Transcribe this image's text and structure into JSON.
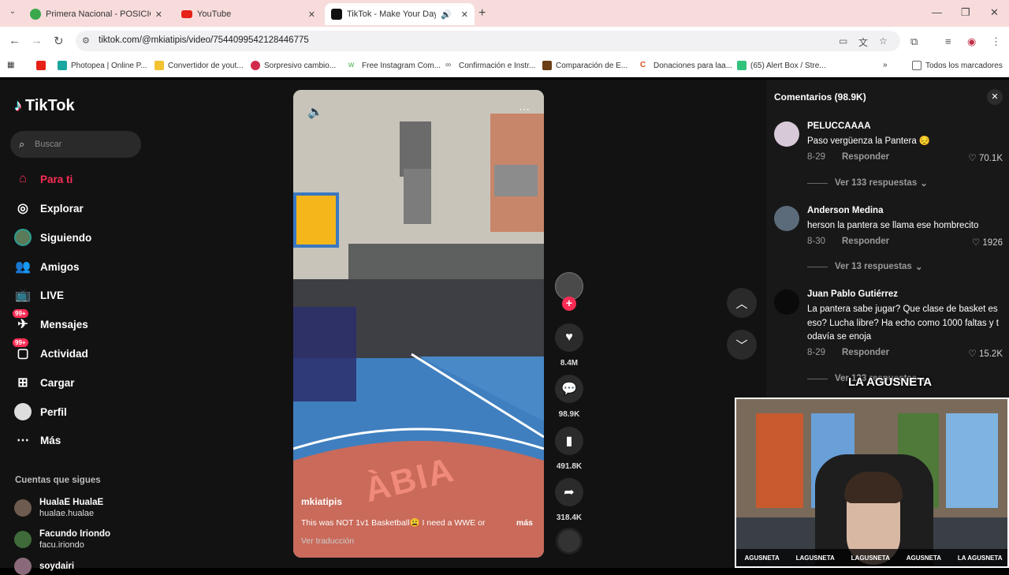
{
  "browser": {
    "tabs": [
      {
        "title": "Primera Nacional - POSICIONES",
        "icon": "globe-green-icon"
      },
      {
        "title": "YouTube",
        "icon": "youtube-icon"
      },
      {
        "title": "TikTok - Make Your Day",
        "icon": "tiktok-icon"
      }
    ],
    "url": "tiktok.com/@mkiatipis/video/7544099542128446775",
    "bookmarks": [
      "Photopea | Online P...",
      "Convertidor de yout...",
      "Sorpresivo cambio...",
      "Free Instagram Com...",
      "Confirmación e Instr...",
      "Comparación de E...",
      "Donaciones para laa...",
      "(65) Alert Box / Stre..."
    ],
    "all_bookmarks": "Todos los marcadores",
    "colors": {
      "tabbar": "#f8dcdc",
      "accent": "#fe2c55"
    }
  },
  "sidebar": {
    "logo": "TikTok",
    "search_placeholder": "Buscar",
    "nav": [
      {
        "label": "Para ti",
        "icon": "home-icon"
      },
      {
        "label": "Explorar",
        "icon": "compass-icon"
      },
      {
        "label": "Siguiendo",
        "icon": "following-avatar-icon"
      },
      {
        "label": "Amigos",
        "icon": "friends-icon"
      },
      {
        "label": "LIVE",
        "icon": "live-tv-icon"
      },
      {
        "label": "Mensajes",
        "icon": "message-icon",
        "badge": "99+"
      },
      {
        "label": "Actividad",
        "icon": "activity-icon",
        "badge": "99+"
      },
      {
        "label": "Cargar",
        "icon": "upload-icon"
      },
      {
        "label": "Perfil",
        "icon": "profile-icon"
      },
      {
        "label": "Más",
        "icon": "more-dots-icon"
      }
    ],
    "following_title": "Cuentas que sigues",
    "following": [
      {
        "name": "HualaE HualaE",
        "handle": "hualae.hualae"
      },
      {
        "name": "Facundo Iriondo",
        "handle": "facu.iriondo"
      },
      {
        "name": "soydairi",
        "handle": ""
      }
    ]
  },
  "video": {
    "author": "mkiatipis",
    "caption": "This was NOT 1v1 Basketball😩 I need a WWE or",
    "more": "más",
    "translate": "Ver traducción",
    "court_text": "ÀBIA"
  },
  "actions": {
    "likes": "8.4M",
    "comments": "98.9K",
    "saves": "491.8K",
    "shares": "318.4K"
  },
  "comments_panel": {
    "title": "Comentarios (98.9K)",
    "reply_label": "Responder",
    "items": [
      {
        "user": "PELUCCAAAA",
        "text": "Paso vergüenza la Pantera 😔",
        "date": "8-29",
        "likes": "70.1K",
        "replies": "Ver 133 respuestas"
      },
      {
        "user": "Anderson Medina",
        "text": "herson la pantera se llama ese hombrecito",
        "date": "8-30",
        "likes": "1926",
        "replies": "Ver 13 respuestas"
      },
      {
        "user": "Juan Pablo Gutiérrez",
        "text": "La pantera sabe jugar? Que clase de basket es eso? Lucha libre? Ha echo como 1000 faltas y t odavía se enoja",
        "date": "8-29",
        "likes": "15.2K",
        "replies": "Ver 123 respuestas"
      }
    ]
  },
  "webcam": {
    "logo": "LA AGUSNETA",
    "socials": [
      "AGUSNETA",
      "LAGUSNETA",
      "LAGUSNETA",
      "AGUSNETA",
      "LA AGUSNETA"
    ]
  }
}
